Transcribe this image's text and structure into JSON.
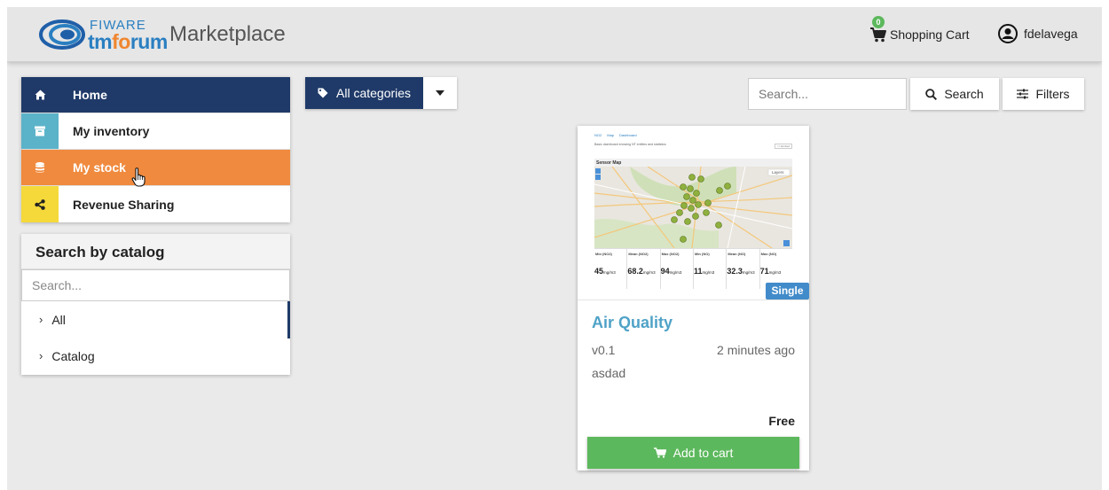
{
  "header": {
    "logo_fiware": "FIWARE",
    "logo_tm": "tm",
    "logo_fo": "fo",
    "logo_rum": "rum",
    "title": "Marketplace",
    "cart_label": "Shopping Cart",
    "cart_count": "0",
    "username": "fdelavega"
  },
  "nav": {
    "items": [
      {
        "label": "Home",
        "icon": "home-icon"
      },
      {
        "label": "My inventory",
        "icon": "archive-icon"
      },
      {
        "label": "My stock",
        "icon": "database-icon"
      },
      {
        "label": "Revenue Sharing",
        "icon": "share-icon"
      }
    ]
  },
  "catalog": {
    "heading": "Search by catalog",
    "search_placeholder": "Search...",
    "items": [
      {
        "label": "All"
      },
      {
        "label": "Catalog"
      }
    ]
  },
  "toolbar": {
    "categories_label": "All categories",
    "search_placeholder": "Search...",
    "search_button": "Search",
    "filters_button": "Filters"
  },
  "offering": {
    "badge": "Single",
    "title": "Air Quality",
    "version": "v0.1",
    "time": "2 minutes ago",
    "description": "asdad",
    "price": "Free",
    "add_button": "Add to cart",
    "thumbnail": {
      "tabs": [
        "NO2",
        "Map",
        "Dashboard"
      ],
      "desc": "Basic dashboard showing NT entities and statistics",
      "embed": "<> Embed",
      "map_title": "Sensor Map",
      "layers": "Layers",
      "stats": [
        {
          "label": "Min (NO2)",
          "value": "45",
          "unit": "mg/m3"
        },
        {
          "label": "Mean (NO2)",
          "value": "68.2",
          "unit": "mg/m3"
        },
        {
          "label": "Max (NO2)",
          "value": "94",
          "unit": "mg/m3"
        },
        {
          "label": "Min (NO)",
          "value": "11",
          "unit": "mg/m3"
        },
        {
          "label": "Mean (NO)",
          "value": "32.3",
          "unit": "mg/m3"
        },
        {
          "label": "Max (NO)",
          "value": "71",
          "unit": "mg/m3"
        }
      ]
    }
  },
  "colors": {
    "home": "#1f3a68",
    "inventory": "#5bb3c9",
    "stock": "#f08a3e",
    "revenue": "#f5d93a",
    "title": "#4fa2c7",
    "add": "#5cb85c",
    "badge": "#428bca"
  }
}
